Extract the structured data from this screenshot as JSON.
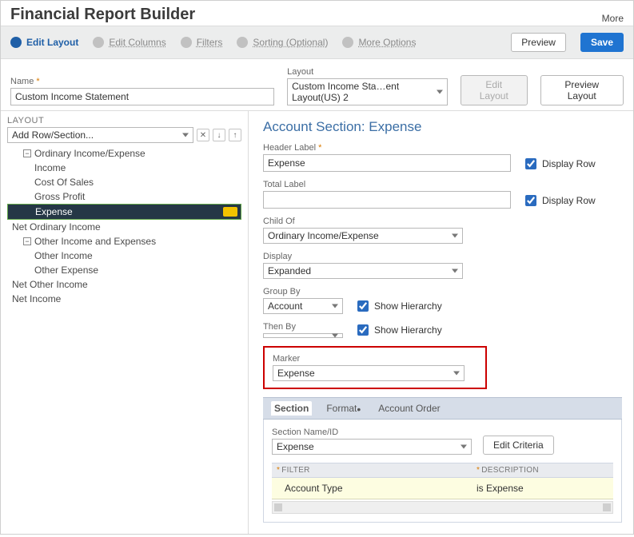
{
  "header": {
    "title": "Financial Report Builder",
    "more": "More"
  },
  "steps": [
    {
      "label": "Edit Layout",
      "active": true
    },
    {
      "label": "Edit Columns",
      "active": false
    },
    {
      "label": "Filters",
      "active": false
    },
    {
      "label": "Sorting (Optional)",
      "active": false
    },
    {
      "label": "More Options",
      "active": false
    }
  ],
  "buttons": {
    "preview": "Preview",
    "save": "Save",
    "edit_layout": "Edit Layout",
    "preview_layout": "Preview Layout"
  },
  "top": {
    "name_label": "Name",
    "name_value": "Custom Income Statement",
    "layout_label": "Layout",
    "layout_value": "Custom Income Sta…ent Layout(US) 2"
  },
  "layout_panel": {
    "title": "LAYOUT",
    "add_row": "Add Row/Section...",
    "tree": [
      {
        "text": "Ordinary Income/Expense",
        "indent": 1,
        "exp": true
      },
      {
        "text": "Income",
        "indent": 2
      },
      {
        "text": "Cost Of Sales",
        "indent": 2
      },
      {
        "text": "Gross Profit",
        "indent": 2
      },
      {
        "text": "Expense",
        "indent": 2,
        "selected": true
      },
      {
        "text": "Net Ordinary Income",
        "indent": 0
      },
      {
        "text": "Other Income and Expenses",
        "indent": 1,
        "exp": true
      },
      {
        "text": "Other Income",
        "indent": 2
      },
      {
        "text": "Other Expense",
        "indent": 2
      },
      {
        "text": "Net Other Income",
        "indent": 0
      },
      {
        "text": "Net Income",
        "indent": 0
      }
    ]
  },
  "detail": {
    "section_title": "Account Section: Expense",
    "header_label_label": "Header Label",
    "header_label_value": "Expense",
    "display_row": "Display Row",
    "total_label_label": "Total Label",
    "total_label_value": "",
    "child_of_label": "Child Of",
    "child_of_value": "Ordinary Income/Expense",
    "display_label": "Display",
    "display_value": "Expanded",
    "group_by_label": "Group By",
    "group_by_value": "Account",
    "show_hierarchy": "Show Hierarchy",
    "then_by_label": "Then By",
    "then_by_value": "",
    "marker_label": "Marker",
    "marker_value": "Expense"
  },
  "subtabs": {
    "tabs": [
      {
        "label": "Section",
        "active": true
      },
      {
        "label": "Format",
        "dot": true
      },
      {
        "label": "Account Order"
      }
    ],
    "section_name_label": "Section Name/ID",
    "section_name_value": "Expense",
    "edit_criteria": "Edit Criteria",
    "head_filter": "Filter",
    "head_desc": "Description",
    "row_filter": "Account Type",
    "row_desc": "is Expense"
  }
}
